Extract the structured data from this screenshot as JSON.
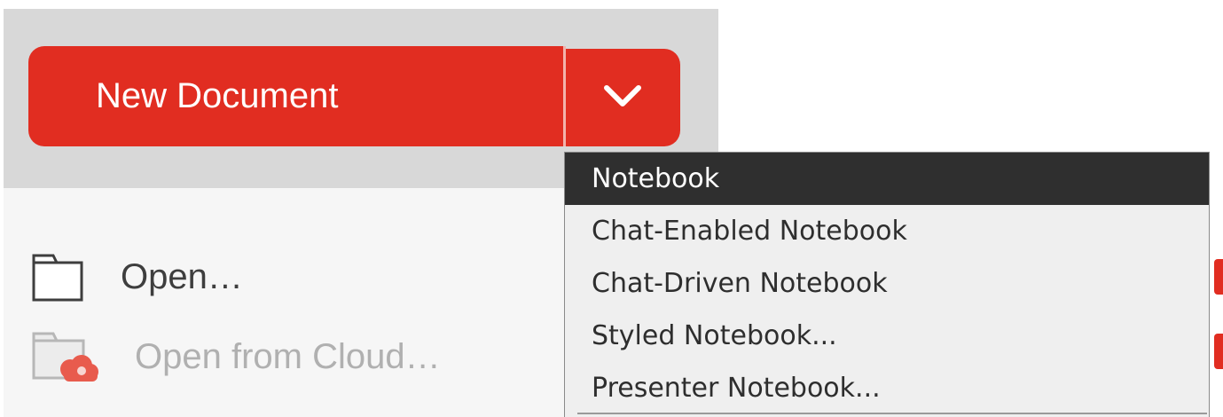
{
  "new_document": {
    "label": "New Document"
  },
  "file_actions": {
    "open_label": "Open…",
    "open_cloud_label": "Open from Cloud…"
  },
  "dropdown_menu": {
    "items": [
      {
        "label": "Notebook",
        "selected": true
      },
      {
        "label": "Chat-Enabled Notebook",
        "selected": false
      },
      {
        "label": "Chat-Driven Notebook",
        "selected": false
      },
      {
        "label": "Styled Notebook...",
        "selected": false
      },
      {
        "label": "Presenter Notebook...",
        "selected": false
      }
    ]
  },
  "icons": {
    "dropdown": "chevron-down-icon",
    "open": "folder-icon",
    "cloud": "cloud-folder-icon"
  },
  "colors": {
    "accent": "#e12d21",
    "panel": "#d8d8d8",
    "menu_bg": "#efefef",
    "menu_selected": "#2f2f2f"
  }
}
